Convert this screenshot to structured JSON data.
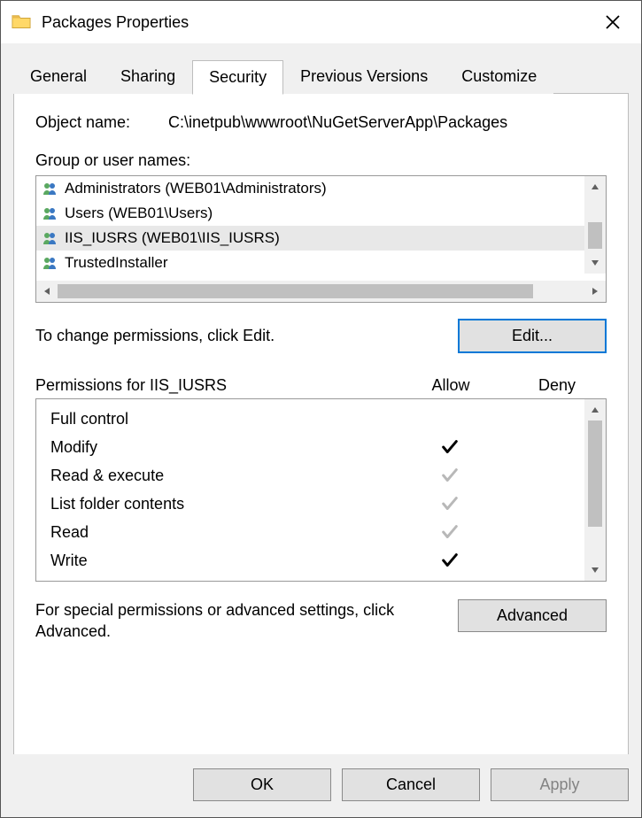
{
  "title": "Packages Properties",
  "tabs": [
    {
      "label": "General"
    },
    {
      "label": "Sharing"
    },
    {
      "label": "Security"
    },
    {
      "label": "Previous Versions"
    },
    {
      "label": "Customize"
    }
  ],
  "active_tab_index": 2,
  "object_name": {
    "label": "Object name:",
    "value": "C:\\inetpub\\wwwroot\\NuGetServerApp\\Packages"
  },
  "groups_label": "Group or user names:",
  "groups": [
    {
      "name": "Administrators (WEB01\\Administrators)",
      "selected": false
    },
    {
      "name": "Users (WEB01\\Users)",
      "selected": false
    },
    {
      "name": "IIS_IUSRS (WEB01\\IIS_IUSRS)",
      "selected": true
    },
    {
      "name": "TrustedInstaller",
      "selected": false
    }
  ],
  "edit_hint": "To change permissions, click Edit.",
  "edit_button": "Edit...",
  "permissions_for_label": "Permissions for IIS_IUSRS",
  "perm_headers": {
    "allow": "Allow",
    "deny": "Deny"
  },
  "permissions": [
    {
      "name": "Full control",
      "allow": "none",
      "deny": "none"
    },
    {
      "name": "Modify",
      "allow": "explicit",
      "deny": "none"
    },
    {
      "name": "Read & execute",
      "allow": "inherited",
      "deny": "none"
    },
    {
      "name": "List folder contents",
      "allow": "inherited",
      "deny": "none"
    },
    {
      "name": "Read",
      "allow": "inherited",
      "deny": "none"
    },
    {
      "name": "Write",
      "allow": "explicit",
      "deny": "none"
    }
  ],
  "advanced_hint": "For special permissions or advanced settings, click Advanced.",
  "advanced_button": "Advanced",
  "buttons": {
    "ok": "OK",
    "cancel": "Cancel",
    "apply": "Apply"
  }
}
